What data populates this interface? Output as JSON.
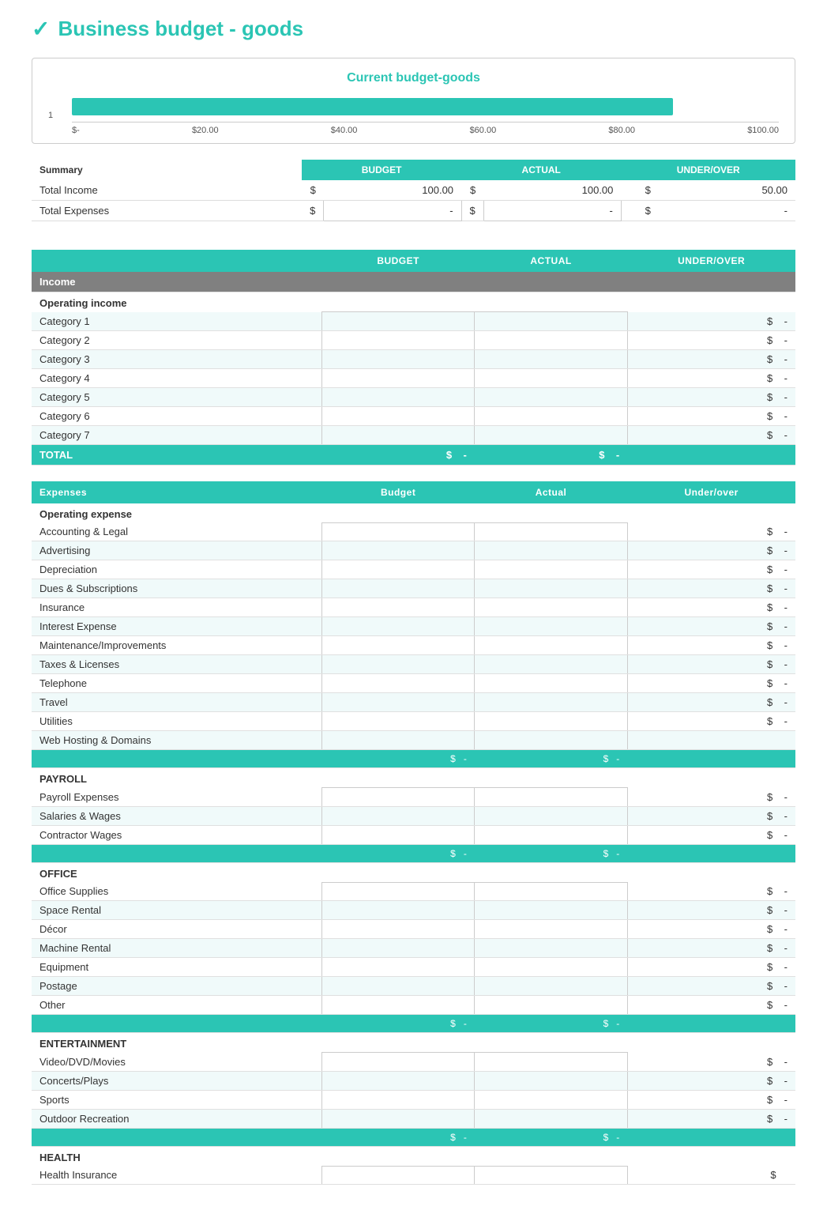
{
  "page": {
    "logo": "✓",
    "title": "Business budget - goods"
  },
  "chart": {
    "title": "Current budget-goods",
    "bar_width_pct": 85,
    "y_label": "1",
    "x_labels": [
      "$-",
      "$20.00",
      "$40.00",
      "$60.00",
      "$80.00",
      "$100.00"
    ]
  },
  "summary": {
    "header_label": "Summary",
    "budget_label": "BUDGET",
    "actual_label": "ACTUAL",
    "underover_label": "UNDER/OVER",
    "rows": [
      {
        "label": "Total Income",
        "budget_dollar": "$",
        "budget_value": "100.00",
        "actual_dollar": "$",
        "actual_value": "100.00",
        "underover_dollar": "$",
        "underover_value": "50.00"
      },
      {
        "label": "Total Expenses",
        "budget_dollar": "$",
        "budget_value": "-",
        "actual_dollar": "$",
        "actual_value": "-",
        "underover_dollar": "$",
        "underover_value": "-"
      }
    ]
  },
  "income_table": {
    "col_budget": "BUDGET",
    "col_actual": "ACTUAL",
    "col_underover": "UNDER/OVER",
    "section_label": "Income",
    "subsection_label": "Operating income",
    "categories": [
      "Category 1",
      "Category 2",
      "Category 3",
      "Category 4",
      "Category 5",
      "Category 6",
      "Category 7"
    ],
    "total_label": "TOTAL",
    "total_budget_dollar": "$",
    "total_budget_value": "-",
    "total_actual_dollar": "$",
    "total_actual_value": "-"
  },
  "expenses_table": {
    "col_label": "Expenses",
    "col_budget": "Budget",
    "col_actual": "Actual",
    "col_underover": "Under/over",
    "subsections": [
      {
        "label": "Operating expense",
        "items": [
          "Accounting & Legal",
          "Advertising",
          "Depreciation",
          "Dues & Subscriptions",
          "Insurance",
          "Interest Expense",
          "Maintenance/Improvements",
          "Taxes & Licenses",
          "Telephone",
          "Travel",
          "Utilities",
          "Web Hosting & Domains"
        ]
      },
      {
        "label": "PAYROLL",
        "items": [
          "Payroll Expenses",
          "Salaries & Wages",
          "Contractor Wages"
        ]
      },
      {
        "label": "OFFICE",
        "items": [
          "Office Supplies",
          "Space Rental",
          "Décor",
          "Machine Rental",
          "Equipment",
          "Postage",
          "Other"
        ]
      },
      {
        "label": "ENTERTAINMENT",
        "items": [
          "Video/DVD/Movies",
          "Concerts/Plays",
          "Sports",
          "Outdoor Recreation"
        ]
      },
      {
        "label": "HEALTH",
        "items": [
          "Health Insurance"
        ]
      }
    ]
  }
}
